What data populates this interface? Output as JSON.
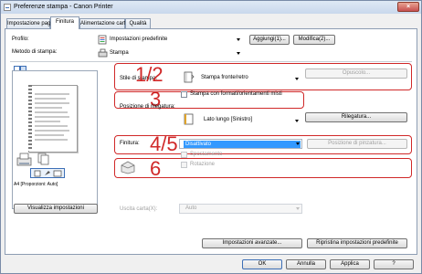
{
  "window": {
    "title": "Preferenze stampa - Canon Printer",
    "close_label": "×"
  },
  "tabs": [
    {
      "label": "Impostazione pagina",
      "active": false
    },
    {
      "label": "Finitura",
      "active": true
    },
    {
      "label": "Alimentazione carta",
      "active": false
    },
    {
      "label": "Qualità",
      "active": false
    }
  ],
  "profile": {
    "label": "Profilo:",
    "value": "Impostazioni predefinite",
    "add_button": "Aggiungi(1)...",
    "edit_button": "Modifica(2)..."
  },
  "output_method": {
    "label": "Metodo di stampa:",
    "value": "Stampa"
  },
  "print_style": {
    "label": "Stile di stampa:",
    "value": "Stampa fronte/retro",
    "options_button": "Opuscolo..."
  },
  "mixed_orientation": {
    "label": "Stampa con formati/orientamenti misti"
  },
  "binding": {
    "label": "Posizione di rilegatura:",
    "value": "Lato lungo [Sinistro]",
    "binding_button": "Rilegatura..."
  },
  "finishing": {
    "label": "Finitura:",
    "value": "Disattivato",
    "staple_position_button": "Posizione di pinzatura...",
    "offset_label": "Spostamento"
  },
  "rotation": {
    "label": "Rotazione"
  },
  "annotations": {
    "a1": "1/2",
    "a3": "3",
    "a45": "4/5",
    "a6": "6"
  },
  "preview": {
    "caption": "A4 [Proporzioni: Auto]"
  },
  "view_settings_button": "Visualizza impostazioni",
  "output_tray": {
    "label": "Uscita carta(X):",
    "value": "Auto"
  },
  "advanced_button": "Impostazioni avanzate...",
  "restore_defaults_button": "Ripristina impostazioni predefinite",
  "footer": {
    "ok": "OK",
    "cancel": "Annulla",
    "apply": "Applica",
    "help": "?"
  },
  "colors": {
    "annotation_red": "#d02828",
    "selection_blue": "#3399ff"
  }
}
